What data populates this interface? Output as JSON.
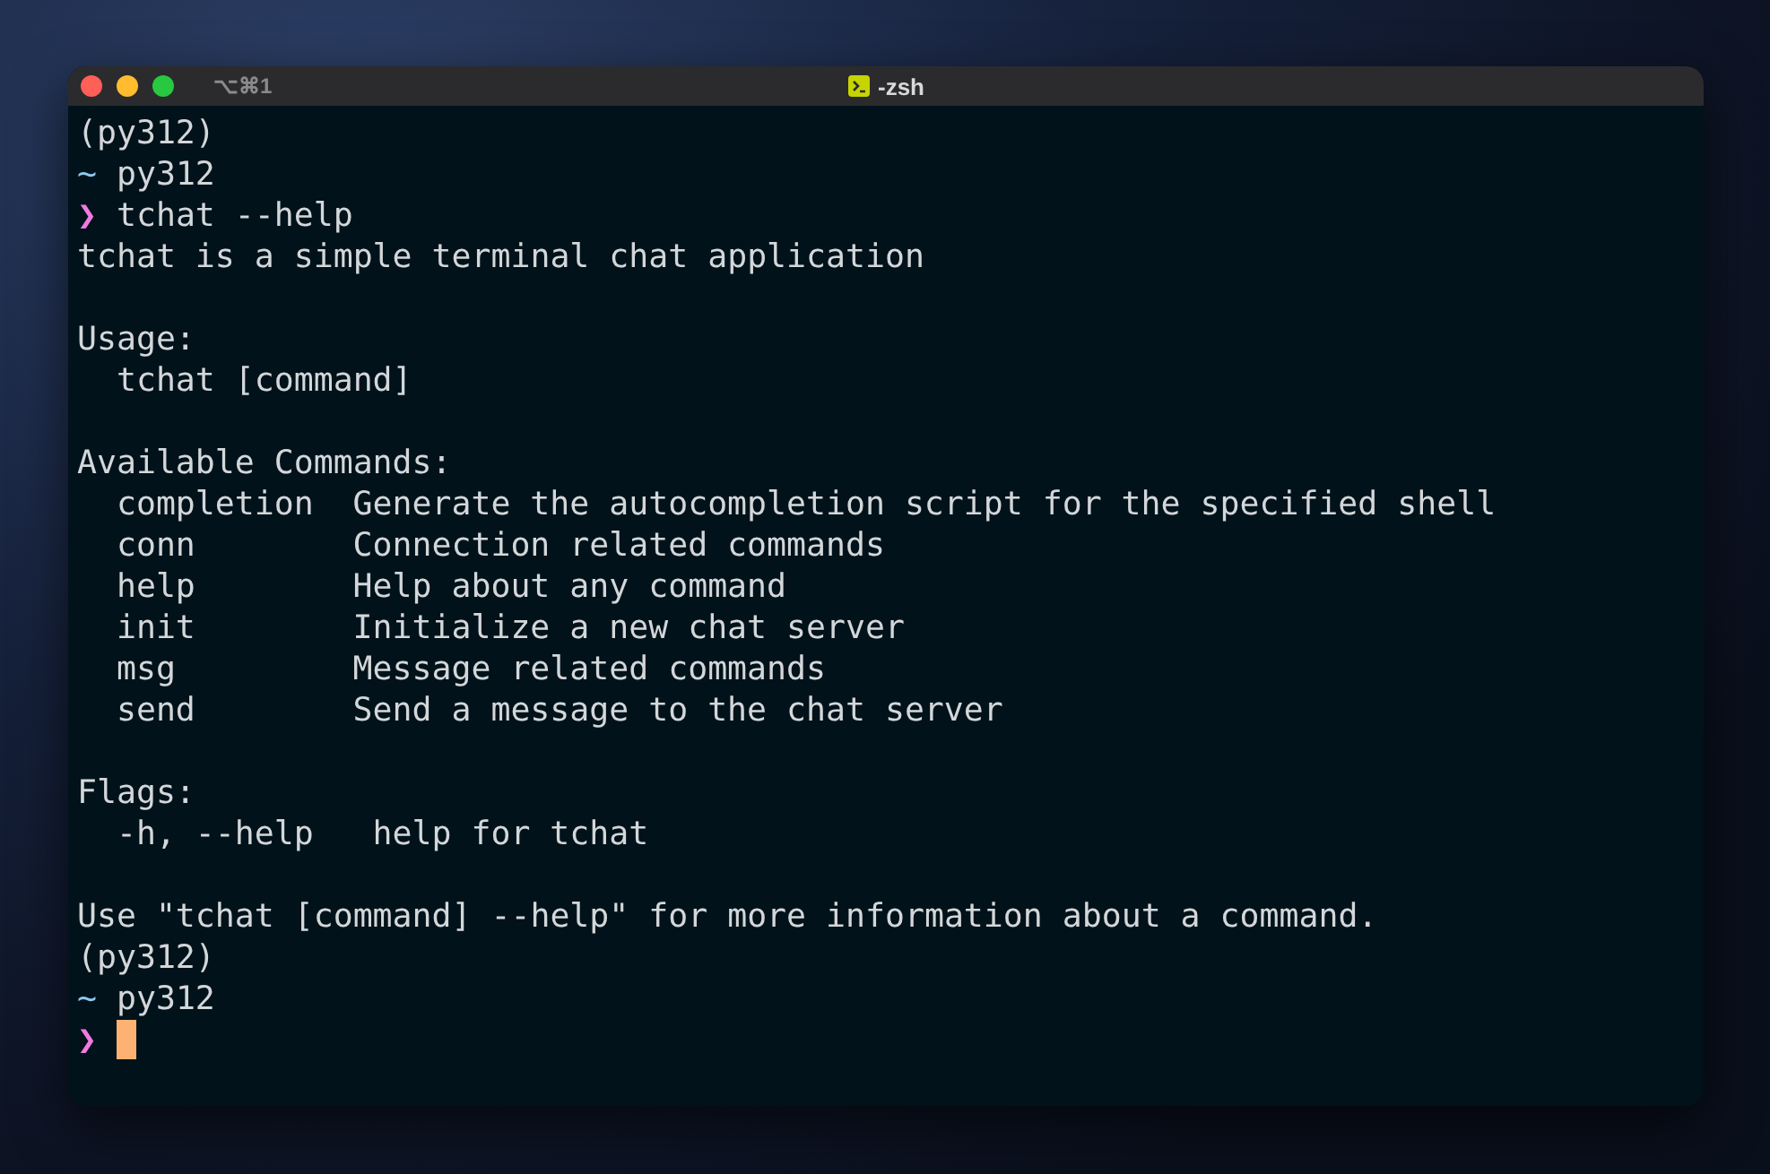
{
  "window": {
    "title": "-zsh",
    "shortcut": "⌥⌘1"
  },
  "lines": [
    {
      "kind": "plain",
      "text": "(py312)"
    },
    {
      "kind": "dir",
      "symbol": "~",
      "text": "py312"
    },
    {
      "kind": "prompt",
      "symbol": "❯",
      "command": "tchat --help",
      "cursor": false
    },
    {
      "kind": "plain",
      "text": "tchat is a simple terminal chat application"
    },
    {
      "kind": "blank"
    },
    {
      "kind": "plain",
      "text": "Usage:"
    },
    {
      "kind": "indented",
      "text": "tchat [command]"
    },
    {
      "kind": "blank"
    },
    {
      "kind": "plain",
      "text": "Available Commands:"
    },
    {
      "kind": "command",
      "name": "completion",
      "description": "Generate the autocompletion script for the specified shell"
    },
    {
      "kind": "command",
      "name": "conn",
      "description": "Connection related commands"
    },
    {
      "kind": "command",
      "name": "help",
      "description": "Help about any command"
    },
    {
      "kind": "command",
      "name": "init",
      "description": "Initialize a new chat server"
    },
    {
      "kind": "command",
      "name": "msg",
      "description": "Message related commands"
    },
    {
      "kind": "command",
      "name": "send",
      "description": "Send a message to the chat server"
    },
    {
      "kind": "blank"
    },
    {
      "kind": "plain",
      "text": "Flags:"
    },
    {
      "kind": "flag",
      "name": "-h, --help",
      "description": "help for tchat"
    },
    {
      "kind": "blank"
    },
    {
      "kind": "plain",
      "text": "Use \"tchat [command] --help\" for more information about a command."
    },
    {
      "kind": "plain",
      "text": "(py312)"
    },
    {
      "kind": "dir",
      "symbol": "~",
      "text": "py312"
    },
    {
      "kind": "prompt",
      "symbol": "❯",
      "cursor": true
    }
  ]
}
